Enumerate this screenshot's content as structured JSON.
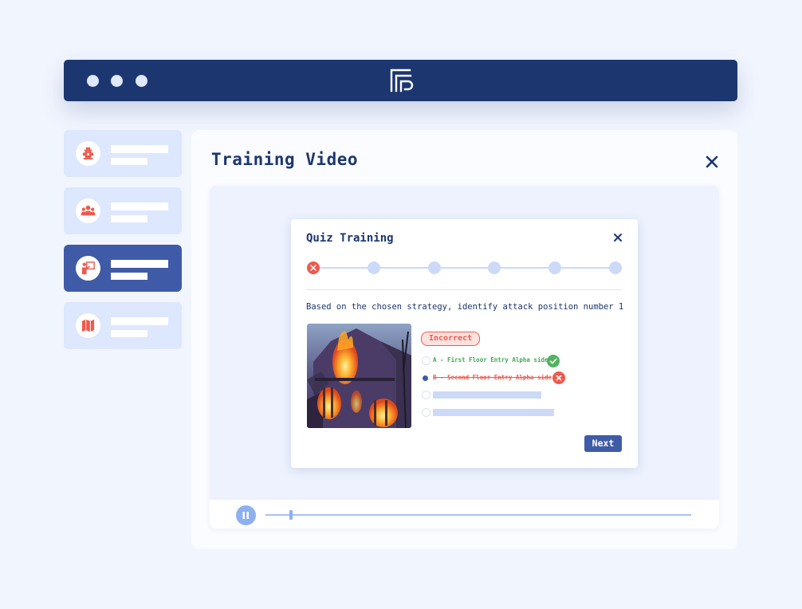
{
  "panel": {
    "title": "Training Video"
  },
  "sidebar": {
    "items": [
      {
        "icon": "fire-hydrant-icon",
        "active": false
      },
      {
        "icon": "team-icon",
        "active": false
      },
      {
        "icon": "training-presenter-icon",
        "active": true
      },
      {
        "icon": "map-icon",
        "active": false
      }
    ]
  },
  "quiz": {
    "title": "Quiz Training",
    "steps": [
      "incorrect",
      "pending",
      "pending",
      "pending",
      "pending",
      "pending"
    ],
    "question": "Based on the chosen strategy, identify attack position number 1",
    "badge": "Incorrect",
    "options": [
      {
        "label": "A - First Floor Entry Alpha side",
        "state": "correct"
      },
      {
        "label": "B - Second Floor Entry Alpha side",
        "state": "incorrect",
        "selected": true
      }
    ],
    "next_label": "Next",
    "image": "burning-house-image"
  },
  "player": {
    "state": "playing",
    "progress": 0.06
  },
  "colors": {
    "navy": "#1c3670",
    "accent": "#3f5ba8",
    "error": "#ef5a4d",
    "success": "#52b45e",
    "background": "#f1f5fe"
  }
}
